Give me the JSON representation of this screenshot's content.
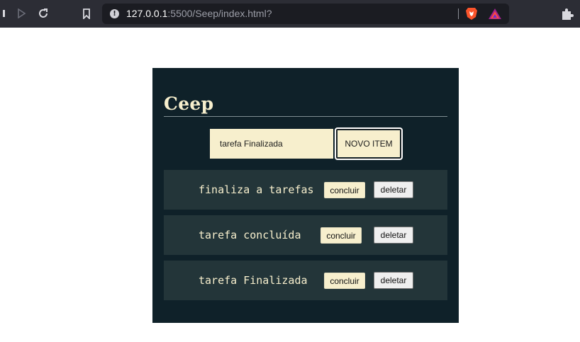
{
  "browser": {
    "url_host": "127.0.0.1",
    "url_rest": ":5500/Seep/index.html?",
    "icons": [
      "back-icon",
      "forward-icon",
      "reload-icon",
      "bookmark-icon",
      "site-info-icon",
      "brave-shields-icon",
      "brave-rewards-icon",
      "extensions-icon"
    ]
  },
  "app": {
    "title": "Ceep",
    "input_value": "tarefa Finalizada",
    "new_button_label": "NOVO ITEM",
    "tasks": [
      {
        "text": "finaliza a tarefas",
        "done_label": "concluir",
        "delete_label": "deletar"
      },
      {
        "text": "tarefa concluída",
        "done_label": "concluir",
        "delete_label": "deletar"
      },
      {
        "text": "tarefa Finalizada",
        "done_label": "concluir",
        "delete_label": "deletar"
      }
    ]
  },
  "colors": {
    "chrome_bg": "#2c2d35",
    "app_bg": "#0f2129",
    "task_bg": "#233539",
    "accent_cream": "#f7efcd"
  }
}
